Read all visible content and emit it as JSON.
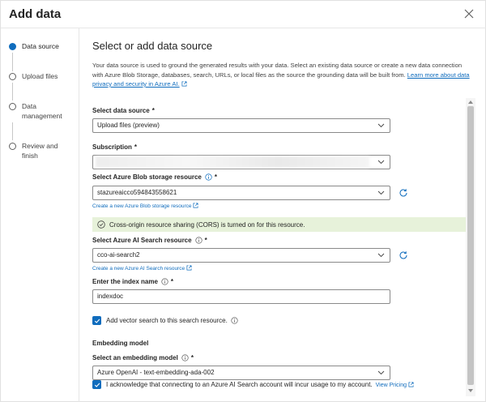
{
  "dialog": {
    "title": "Add data"
  },
  "steps": [
    {
      "label": "Data source",
      "active": true
    },
    {
      "label": "Upload files",
      "active": false
    },
    {
      "label": "Data management",
      "active": false
    },
    {
      "label": "Review and finish",
      "active": false
    }
  ],
  "main": {
    "title": "Select or add data source",
    "description": "Your data source is used to ground the generated results with your data. Select an existing data source or create a new data connection with Azure Blob Storage, databases, search, URLs, or local files as the source the grounding data will be built from.",
    "learn_more": "Learn more about data privacy and security in Azure AI."
  },
  "form": {
    "data_source": {
      "label": "Select data source",
      "required": "*",
      "value": "Upload files (preview)"
    },
    "subscription": {
      "label": "Subscription",
      "required": "*",
      "value": ""
    },
    "blob": {
      "label": "Select Azure Blob storage resource",
      "required": "*",
      "value": "stazureaicco594843558621",
      "create_link": "Create a new Azure Blob storage resource"
    },
    "cors_message": "Cross-origin resource sharing (CORS) is turned on for this resource.",
    "search": {
      "label": "Select Azure AI Search resource",
      "required": "*",
      "value": "cco-ai-search2",
      "create_link": "Create a new Azure AI Search resource"
    },
    "index": {
      "label": "Enter the index name",
      "required": "*",
      "value": "indexdoc"
    },
    "vector_search": {
      "label": "Add vector search to this search resource.",
      "checked": true
    },
    "embedding_section": "Embedding model",
    "embedding": {
      "label": "Select an embedding model",
      "required": "*",
      "value": "Azure OpenAI - text-embedding-ada-002"
    },
    "acknowledge": {
      "label": "I acknowledge that connecting to an Azure AI Search account will incur usage to my account.",
      "link": "View Pricing",
      "checked": true
    }
  },
  "colors": {
    "accent": "#0f6cbd",
    "success_bg": "#e7f2da",
    "success_icon": "#107c10"
  }
}
